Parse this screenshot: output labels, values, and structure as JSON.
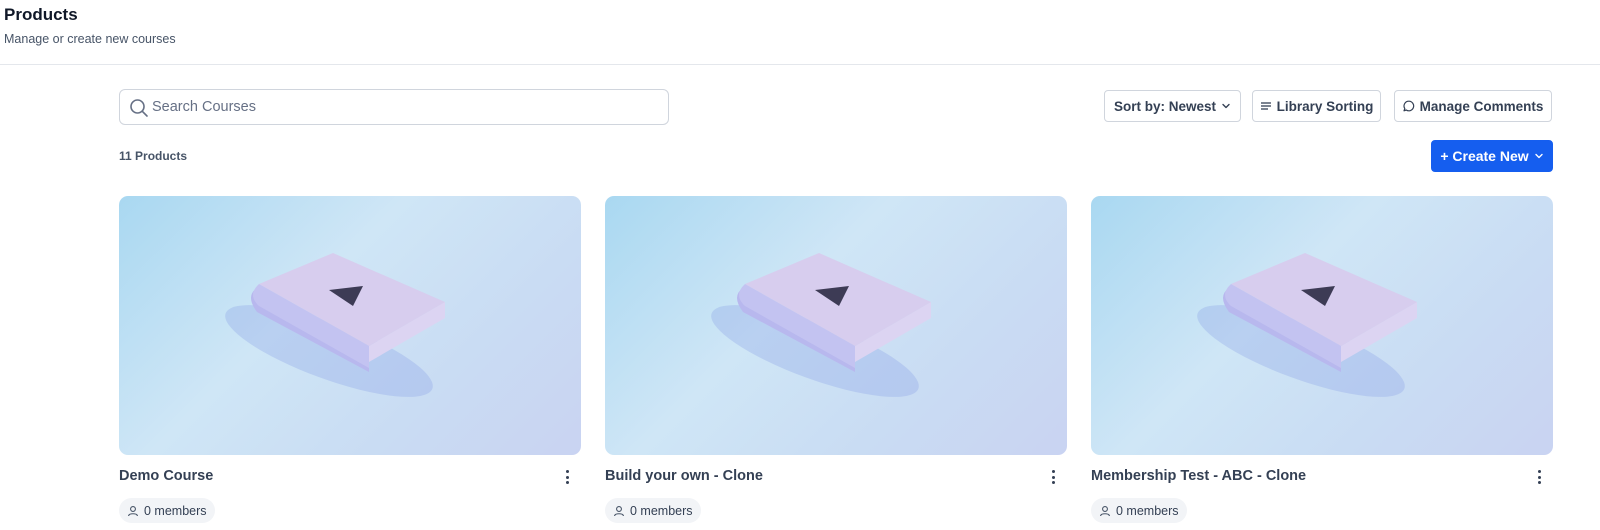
{
  "header": {
    "title": "Products",
    "subtitle": "Manage or create new courses"
  },
  "search": {
    "placeholder": "Search Courses",
    "value": ""
  },
  "toolbar": {
    "sort_label": "Sort by: Newest",
    "library_sorting_label": "Library Sorting",
    "manage_comments_label": "Manage Comments",
    "create_new_label": "+ Create New"
  },
  "products": {
    "count_label": "11 Products",
    "items": [
      {
        "title": "Demo Course",
        "members": "0 members"
      },
      {
        "title": "Build your own - Clone",
        "members": "0 members"
      },
      {
        "title": "Membership Test - ABC - Clone",
        "members": "0 members"
      }
    ]
  },
  "colors": {
    "primary": "#155eef",
    "text_dark": "#101828",
    "text_muted": "#475467",
    "border": "#d0d5dd"
  },
  "icons": {
    "search": "search-icon",
    "sort_chevron": "chevron-down-icon",
    "library_sorting": "lines-icon",
    "manage_comments": "chat-bubble-icon",
    "create_chevron": "chevron-down-icon",
    "card_menu": "kebab-menu-icon",
    "members": "user-icon",
    "thumbnail": "book-play-icon"
  }
}
